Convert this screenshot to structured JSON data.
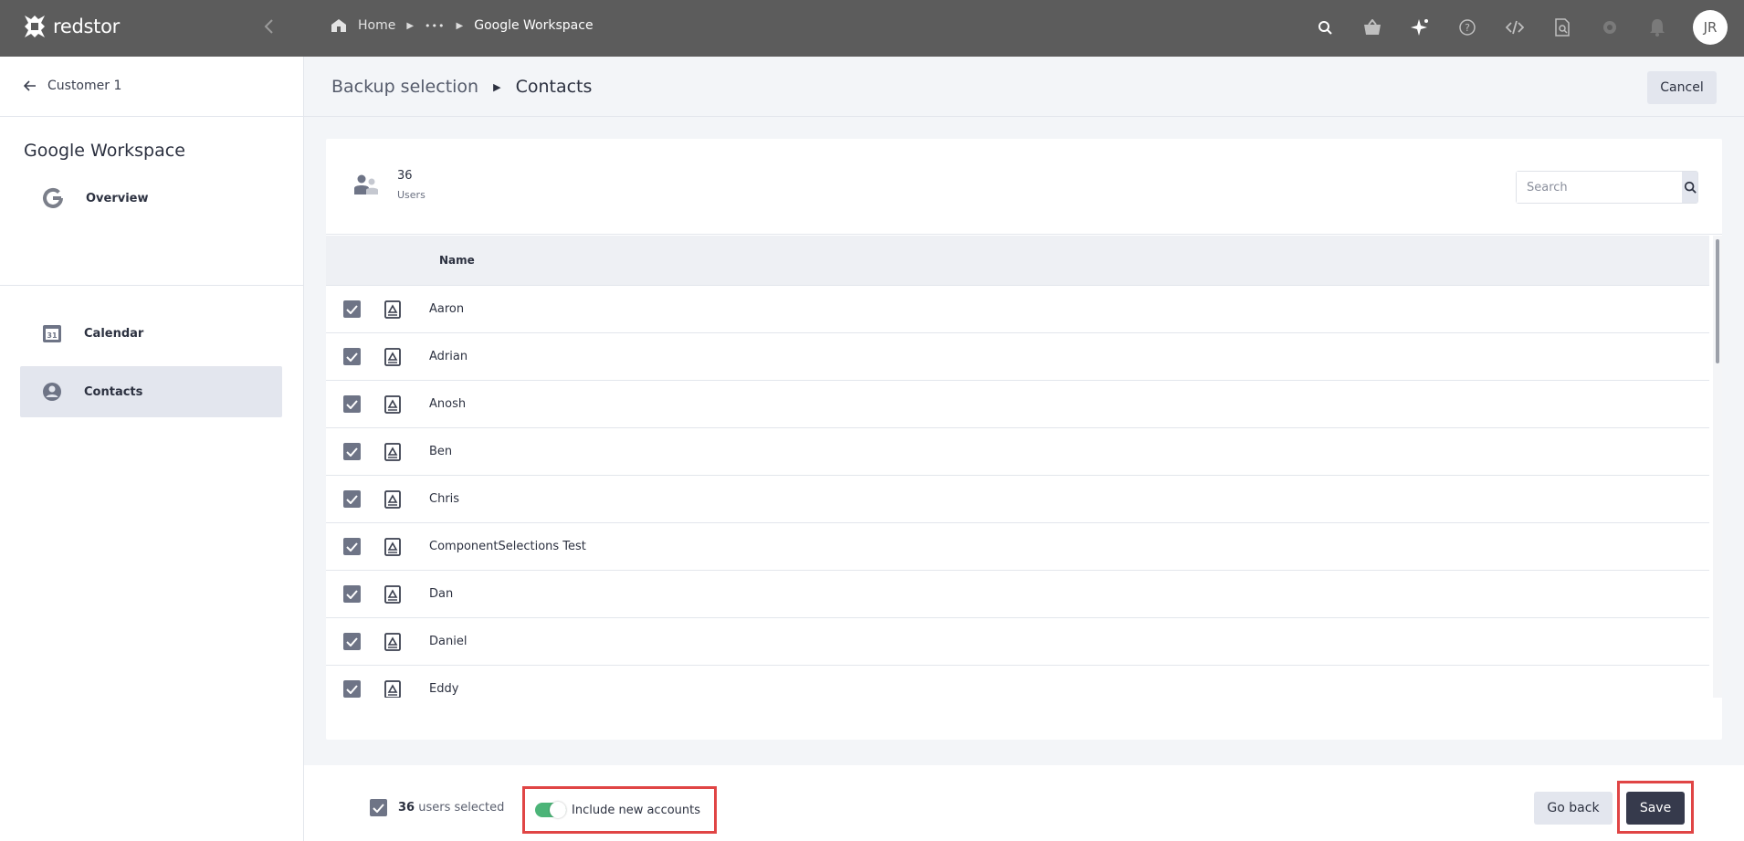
{
  "topbar": {
    "brand": "redstor",
    "breadcrumb": {
      "home": "Home",
      "ellipsis": "•••",
      "current": "Google Workspace"
    },
    "icons": [
      "search-icon",
      "basket-icon",
      "sparkle-icon",
      "help-icon",
      "code-icon",
      "search-document-icon",
      "gear-icon",
      "bell-icon"
    ],
    "avatar_initials": "JR"
  },
  "sidebar": {
    "back_label": "Customer 1",
    "title": "Google Workspace",
    "items": [
      {
        "label": "Overview",
        "icon": "google-icon",
        "active": false
      },
      {
        "label": "Calendar",
        "icon": "calendar-icon",
        "active": false
      },
      {
        "label": "Contacts",
        "icon": "person-icon",
        "active": true
      }
    ]
  },
  "header": {
    "parent": "Backup selection",
    "current": "Contacts",
    "cancel_label": "Cancel"
  },
  "card": {
    "count": "36",
    "count_label": "Users",
    "search_placeholder": "Search",
    "column_name": "Name",
    "rows": [
      {
        "name": "Aaron",
        "checked": true
      },
      {
        "name": "Adrian",
        "checked": true
      },
      {
        "name": "Anosh",
        "checked": true
      },
      {
        "name": "Ben",
        "checked": true
      },
      {
        "name": "Chris",
        "checked": true
      },
      {
        "name": "ComponentSelections Test",
        "checked": true
      },
      {
        "name": "Dan",
        "checked": true
      },
      {
        "name": "Daniel",
        "checked": true
      },
      {
        "name": "Eddy",
        "checked": true
      }
    ]
  },
  "footer": {
    "selected_count": "36",
    "selected_suffix": "users selected",
    "include_new_label": "Include new accounts",
    "include_new_enabled": true,
    "go_back_label": "Go back",
    "save_label": "Save"
  },
  "colors": {
    "topbar": "#5c5c5c",
    "accent_dark": "#363a4c",
    "toggle_on": "#4cb478",
    "highlight": "#e04545"
  }
}
